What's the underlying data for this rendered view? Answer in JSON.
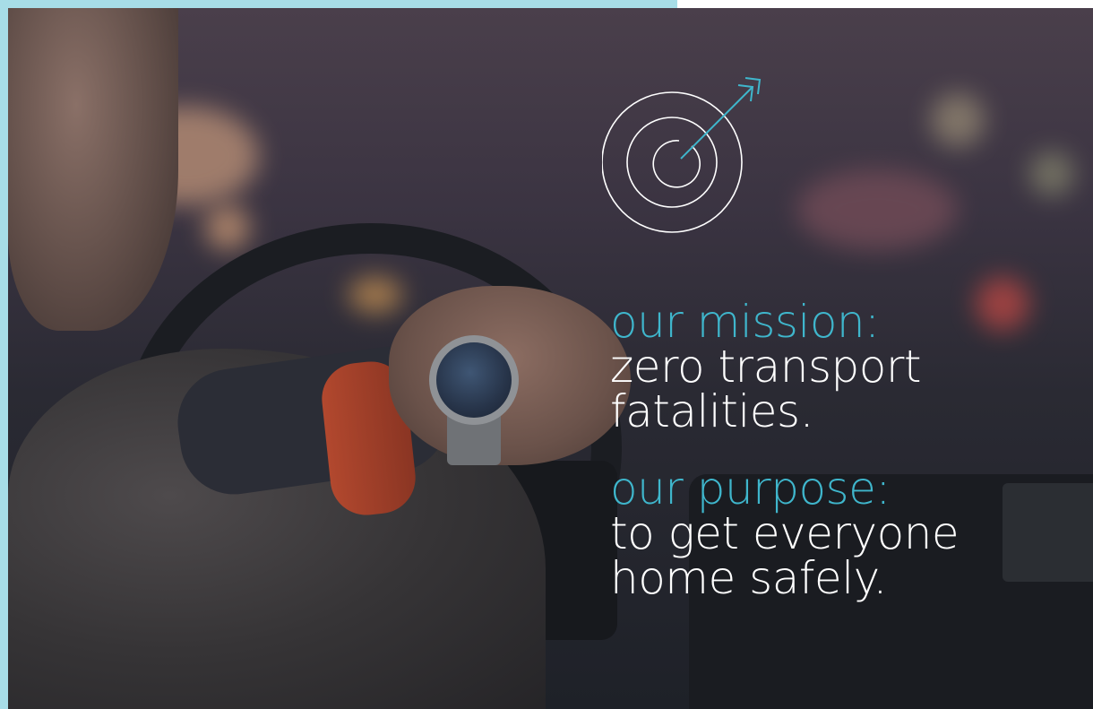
{
  "mission": {
    "label": "our mission:",
    "line1": "zero transport",
    "line2": "fatalities."
  },
  "purpose": {
    "label": "our purpose:",
    "line1": "to get everyone",
    "line2": "home safely."
  },
  "icons": {
    "target": "target-arrow-icon"
  },
  "colors": {
    "accent": "#3fb6cc",
    "frame": "#a7dde7",
    "text": "#ffffff"
  }
}
